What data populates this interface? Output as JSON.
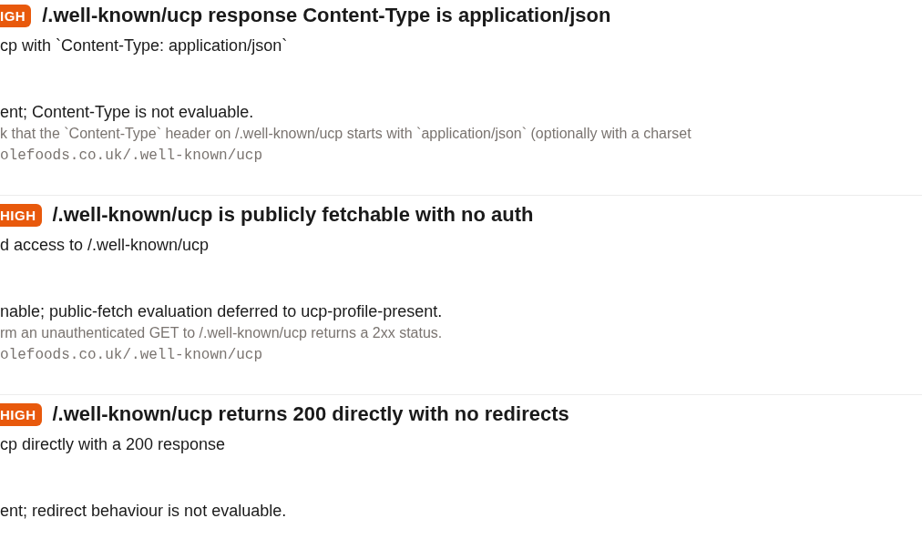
{
  "findings": [
    {
      "severity": "IGH",
      "kind": "high",
      "title": "/.well-known/ucp response Content-Type is application/json",
      "description": "cp with `Content-Type: application/json`",
      "result": "ent; Content-Type is not evaluable.",
      "detail": "k that the `Content-Type` header on /.well-known/ucp starts with `application/json` (optionally with a charset",
      "url": "olefoods.co.uk/.well-known/ucp"
    },
    {
      "severity": "HIGH",
      "kind": "high",
      "title": "/.well-known/ucp is publicly fetchable with no auth",
      "description": "d access to /.well-known/ucp",
      "result": "nable; public-fetch evaluation deferred to ucp-profile-present.",
      "detail": "rm an unauthenticated GET to /.well-known/ucp returns a 2xx status.",
      "url": "olefoods.co.uk/.well-known/ucp"
    },
    {
      "severity": "HIGH",
      "kind": "high",
      "title": "/.well-known/ucp returns 200 directly with no redirects",
      "description": "cp directly with a 200 response",
      "result": "ent; redirect behaviour is not evaluable."
    }
  ]
}
